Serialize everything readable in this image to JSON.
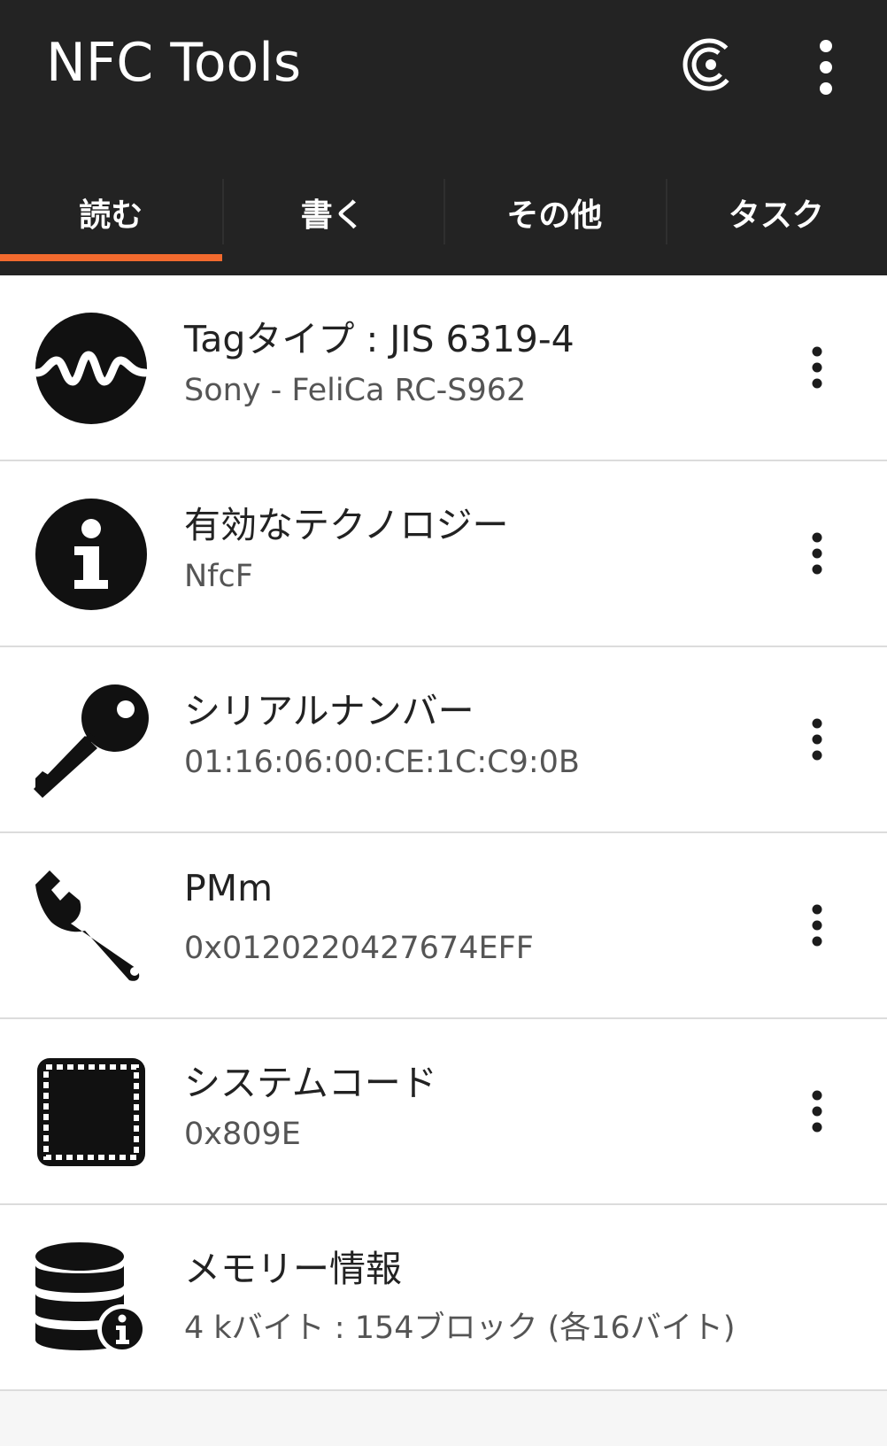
{
  "app": {
    "title": "NFC Tools"
  },
  "tabs": [
    {
      "label": "読む",
      "active": true
    },
    {
      "label": "書く",
      "active": false
    },
    {
      "label": "その他",
      "active": false
    },
    {
      "label": "タスク",
      "active": false
    }
  ],
  "colors": {
    "appbar": "#232323",
    "accent": "#f26a2e",
    "background": "#ffffff"
  },
  "items": [
    {
      "icon": "waveform-icon",
      "title": "Tagタイプ : JIS 6319-4",
      "subtitle": "Sony - FeliCa RC-S962"
    },
    {
      "icon": "info-icon",
      "title": "有効なテクノロジー",
      "subtitle": "NfcF"
    },
    {
      "icon": "key-icon",
      "title": "シリアルナンバー",
      "subtitle": "01:16:06:00:CE:1C:C9:0B"
    },
    {
      "icon": "wrench-icon",
      "title": "PMm",
      "subtitle": "0x0120220427674EFF"
    },
    {
      "icon": "chip-icon",
      "title": "システムコード",
      "subtitle": "0x809E"
    },
    {
      "icon": "database-info-icon",
      "title": "メモリー情報",
      "subtitle": "4 kバイト : 154ブロック (各16バイト)"
    }
  ]
}
